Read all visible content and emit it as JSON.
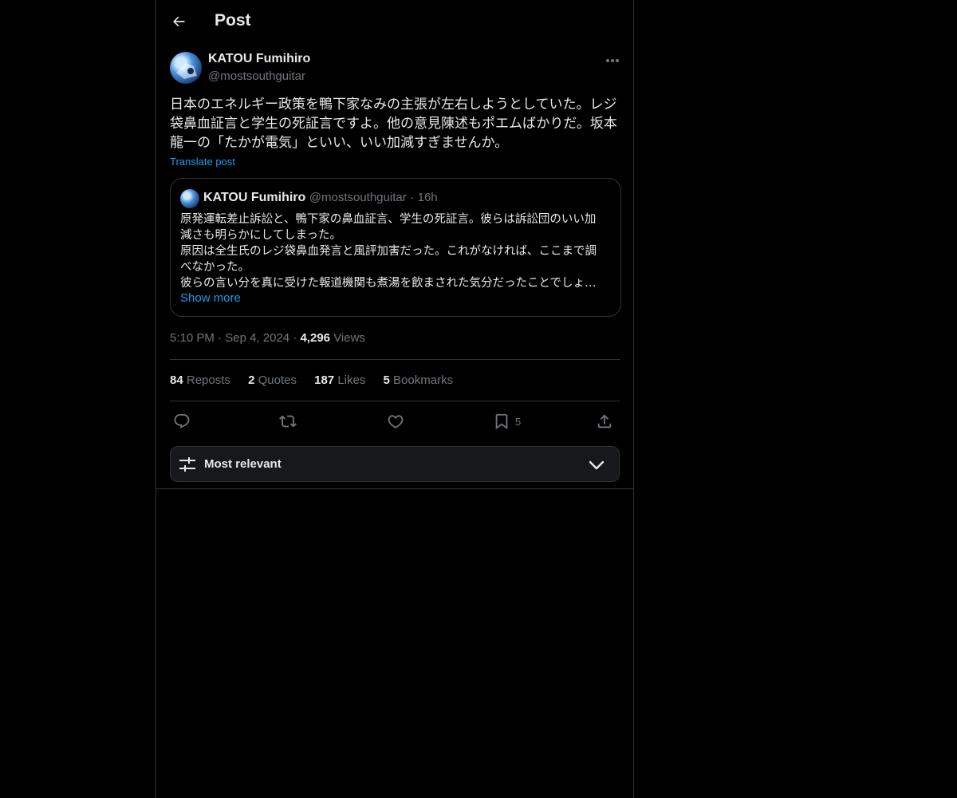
{
  "header": {
    "title": "Post"
  },
  "author": {
    "name": "KATOU Fumihiro",
    "handle": "@mostsouthguitar"
  },
  "post": {
    "text": "日本のエネルギー政策を鴨下家なみの主張が左右しようとしていた。レジ袋鼻血証言と学生の死証言ですよ。他の意見陳述もポエムばかりだ。坂本龍一の「たかが電気」といい、いい加減すぎませんか。",
    "translate_label": "Translate post"
  },
  "quote": {
    "name": "KATOU Fumihiro",
    "handle": "@mostsouthguitar",
    "separator": "·",
    "age": "16h",
    "lines": [
      "原発運転差止訴訟と、鴨下家の鼻血証言、学生の死証言。彼らは訴訟団のいい加",
      "減さも明らかにしてしまった。",
      "原因は全生氏のレジ袋鼻血発言と風評加害だった。これがなければ、ここまで調",
      "べなかった。",
      "彼らの言い分を真に受けた報道機関も煮湯を飲まされた気分だったことでしょ…"
    ],
    "show_more": "Show more"
  },
  "meta": {
    "time": "5:10 PM",
    "date": "Sep 4, 2024",
    "separator": "·",
    "views_count": "4,296",
    "views_label": "Views"
  },
  "stats": {
    "reposts_count": "84",
    "reposts_label": "Reposts",
    "quotes_count": "2",
    "quotes_label": "Quotes",
    "likes_count": "187",
    "likes_label": "Likes",
    "bookmarks_count": "5",
    "bookmarks_label": "Bookmarks"
  },
  "actions": {
    "reply_icon": "reply-icon",
    "repost_icon": "repost-icon",
    "like_icon": "heart-icon",
    "bookmark_icon": "bookmark-icon",
    "bookmark_count": "5",
    "share_icon": "share-icon"
  },
  "sort": {
    "label": "Most relevant",
    "icon": "sliders-icon",
    "chevron": "chevron-down-icon"
  },
  "colors": {
    "accent": "#1d9bf0",
    "muted": "#71767b",
    "border": "#2f3336",
    "background": "#000000"
  }
}
